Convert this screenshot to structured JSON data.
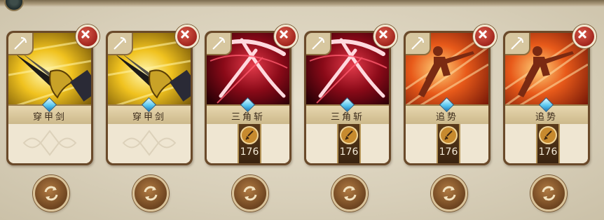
{
  "colors": {
    "gold": "#f0c21f",
    "crimson": "#b3001b",
    "orange": "#e85a1a",
    "close_red": "#c0392b",
    "gem_blue": "#5cc8ef"
  },
  "cards": [
    {
      "name": "穿甲剑",
      "art": "gold-sword-art",
      "attack": null
    },
    {
      "name": "穿甲剑",
      "art": "gold-sword-art",
      "attack": null
    },
    {
      "name": "三角斩",
      "art": "red-slash-art",
      "attack": "176"
    },
    {
      "name": "三角斩",
      "art": "red-slash-art",
      "attack": "176"
    },
    {
      "name": "追势",
      "art": "orange-dash-art",
      "attack": "176"
    },
    {
      "name": "追势",
      "art": "orange-dash-art",
      "attack": "176"
    }
  ],
  "icons": {
    "card_corner": "wand-icon",
    "close": "close-icon",
    "gem": "blue-gem-icon",
    "attack": "sword-icon",
    "refresh": "refresh-icon"
  }
}
